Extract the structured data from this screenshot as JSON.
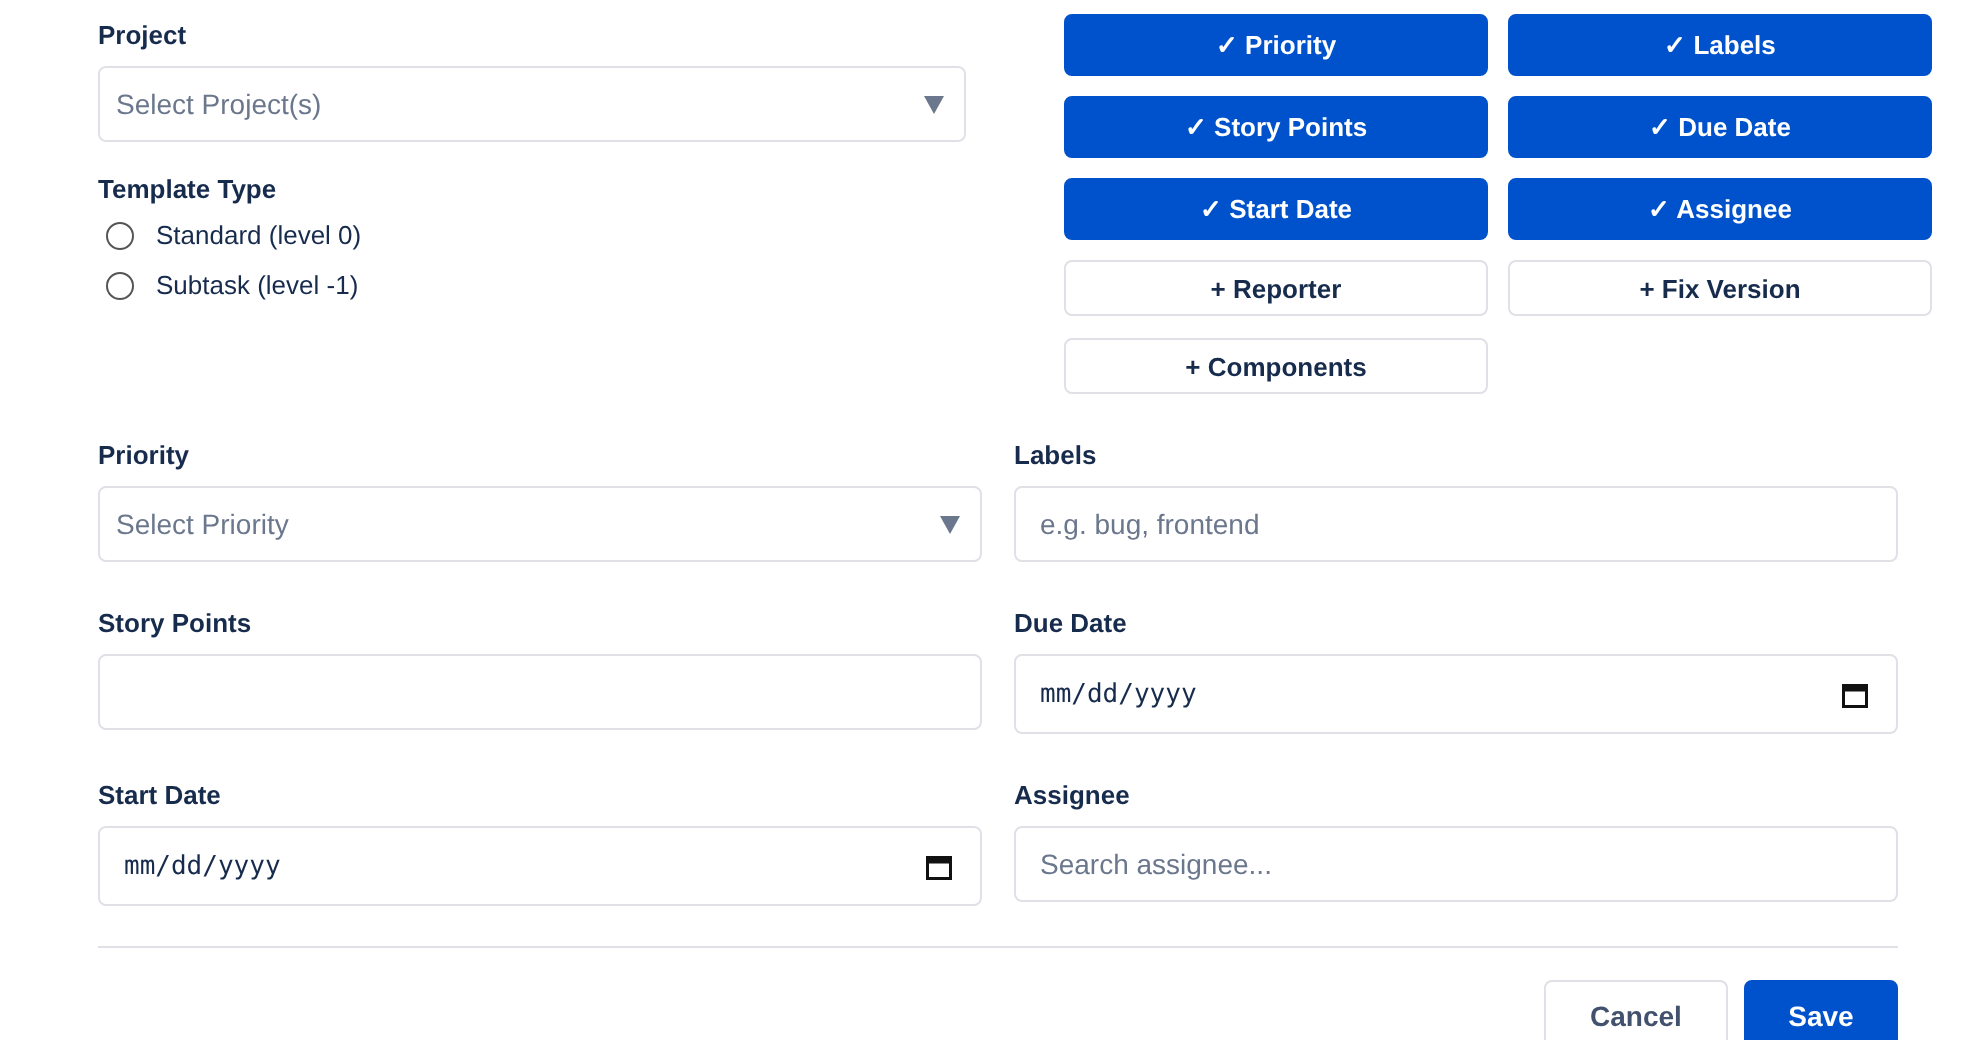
{
  "project": {
    "label": "Project",
    "placeholder": "Select Project(s)"
  },
  "template_type": {
    "label": "Template Type",
    "options": [
      {
        "label": "Standard (level 0)",
        "selected": false
      },
      {
        "label": "Subtask (level -1)",
        "selected": false
      }
    ]
  },
  "field_toggles": [
    {
      "label": "✓ Priority",
      "selected": true
    },
    {
      "label": "✓ Labels",
      "selected": true
    },
    {
      "label": "✓ Story Points",
      "selected": true
    },
    {
      "label": "✓ Due Date",
      "selected": true
    },
    {
      "label": "✓ Start Date",
      "selected": true
    },
    {
      "label": "✓ Assignee",
      "selected": true
    },
    {
      "label": "+ Reporter",
      "selected": false
    },
    {
      "label": "+ Fix Version",
      "selected": false
    },
    {
      "label": "+ Components",
      "selected": false
    }
  ],
  "fields": [
    {
      "label": "Priority",
      "kind": "select",
      "placeholder": "Select Priority"
    },
    {
      "label": "Labels",
      "kind": "text",
      "placeholder": "e.g. bug, frontend"
    },
    {
      "label": "Story Points",
      "kind": "text"
    },
    {
      "label": "Due Date",
      "kind": "date",
      "value": "mm/dd/yyyy"
    },
    {
      "label": "Start Date",
      "kind": "date",
      "value": "mm/dd/yyyy"
    },
    {
      "label": "Assignee",
      "kind": "text",
      "placeholder": "Search assignee..."
    }
  ],
  "buttons": [
    {
      "label": "Cancel",
      "kind": "secondary"
    },
    {
      "label": "Save",
      "kind": "primary"
    }
  ]
}
